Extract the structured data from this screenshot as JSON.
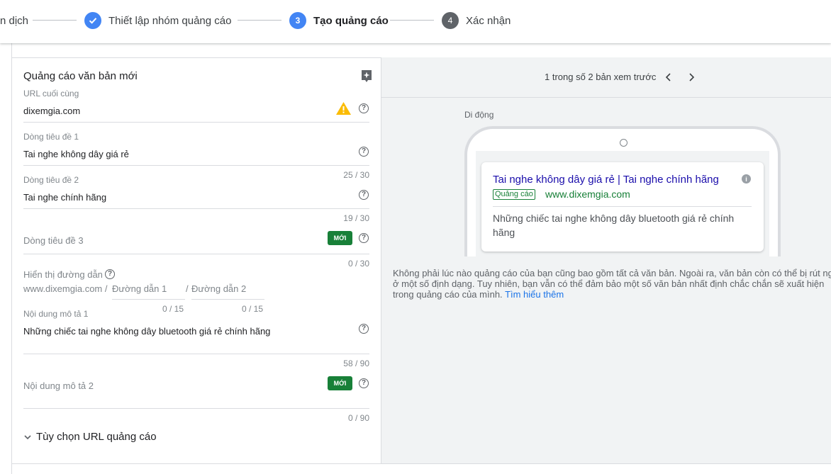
{
  "stepper": {
    "steps": [
      {
        "label": "n dịch",
        "state": "done"
      },
      {
        "label": "Thiết lập nhóm quảng cáo",
        "state": "done"
      },
      {
        "label": "Tạo quảng cáo",
        "number": "3",
        "state": "active"
      },
      {
        "label": "Xác nhận",
        "number": "4",
        "state": "todo"
      }
    ]
  },
  "form": {
    "title": "Quảng cáo văn bản mới",
    "final_url": {
      "label": "URL cuối cùng",
      "value": "dixemgia.com"
    },
    "headline1": {
      "label": "Dòng tiêu đề 1",
      "value": "Tai nghe không dây giá rẻ",
      "counter": "25 / 30"
    },
    "headline2": {
      "label": "Dòng tiêu đề 2",
      "value": "Tai nghe chính hãng",
      "counter": "19 / 30"
    },
    "headline3": {
      "placeholder": "Dòng tiêu đề 3",
      "badge": "MỚI",
      "counter": "0 / 30"
    },
    "display_path": {
      "label": "Hiển thị đường dẫn",
      "prefix": "www.dixemgia.com /",
      "path1": {
        "placeholder": "Đường dẫn 1",
        "counter": "0 / 15"
      },
      "separator": "/",
      "path2": {
        "placeholder": "Đường dẫn 2",
        "counter": "0 / 15"
      }
    },
    "description1": {
      "label": "Nội dung mô tả 1",
      "value": "Những chiếc tai nghe không dây bluetooth giá rẻ chính hãng",
      "counter": "58 / 90"
    },
    "description2": {
      "placeholder": "Nội dung mô tả 2",
      "badge": "MỚI",
      "counter": "0 / 90"
    },
    "url_options": "Tùy chọn URL quảng cáo"
  },
  "preview": {
    "count": "1 trong số 2 bản xem trước",
    "device": "Di động",
    "ad": {
      "title": "Tai nghe không dây giá rẻ | Tai nghe chính hãng",
      "badge": "Quảng cáo",
      "url": "www.dixemgia.com",
      "description": "Những chiếc tai nghe không dây bluetooth giá rẻ chính hãng"
    },
    "note": "Không phải lúc nào quảng cáo của bạn cũng bao gồm tất cả văn bản. Ngoài ra, văn bản còn có thể bị rút ngắn ở một số định dạng. Tuy nhiên, bạn vẫn có thể đảm bảo một số văn bản nhất định chắc chắn sẽ xuất hiện trong quảng cáo của mình.",
    "learn_more": "Tìm hiểu thêm"
  },
  "colors": {
    "accent": "#4285f4",
    "new_badge": "#188038",
    "warning": "#fbbc04",
    "link": "#1a0dab"
  }
}
